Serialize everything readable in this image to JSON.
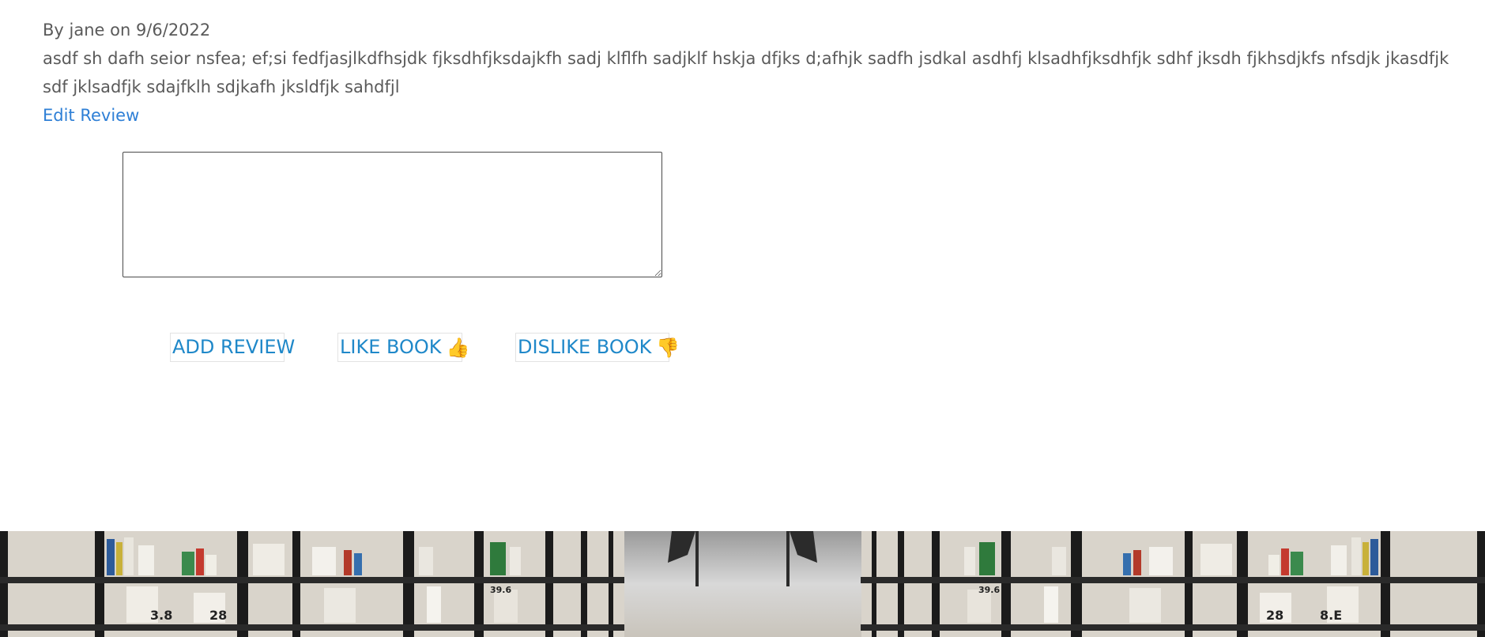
{
  "review": {
    "meta": "By jane on 9/6/2022",
    "body": "asdf sh dafh seior nsfea; ef;si fedfjasjlkdfhsjdk fjksdhfjksdajkfh sadj klflfh sadjklf hskja dfjks d;afhjk sadfh jsdkal asdhfj klsadhfjksdhfjk sdhf jksdh fjkhsdjkfs nfsdjk jkasdfjk sdf jklsadfjk sdajfklh sdjkafh jksldfjk sahdfjl",
    "edit_label": "Edit Review"
  },
  "form": {
    "textarea_value": "",
    "add_label": "ADD REVIEW",
    "like_label": "LIKE BOOK",
    "dislike_label": "DISLIKE BOOK",
    "like_icon": "👍",
    "dislike_icon": "👎"
  },
  "banner": {
    "shelf_labels": [
      "3.8",
      "28",
      "39.6",
      "28",
      "8.E",
      "39.6"
    ]
  },
  "colors": {
    "text": "#5a5a5a",
    "link": "#2e7fd6",
    "button_text": "#1f88c9"
  }
}
